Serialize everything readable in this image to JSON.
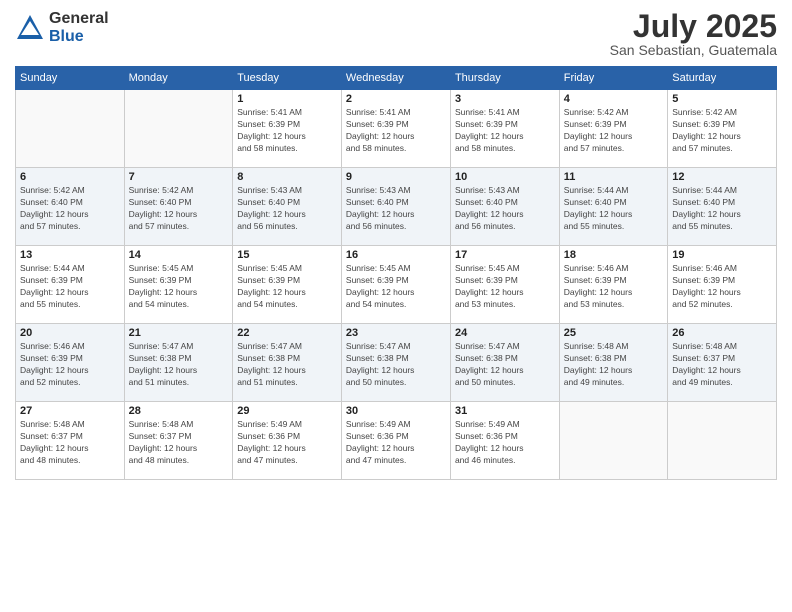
{
  "logo": {
    "general": "General",
    "blue": "Blue"
  },
  "title": "July 2025",
  "location": "San Sebastian, Guatemala",
  "days_of_week": [
    "Sunday",
    "Monday",
    "Tuesday",
    "Wednesday",
    "Thursday",
    "Friday",
    "Saturday"
  ],
  "weeks": [
    [
      {
        "day": "",
        "info": ""
      },
      {
        "day": "",
        "info": ""
      },
      {
        "day": "1",
        "info": "Sunrise: 5:41 AM\nSunset: 6:39 PM\nDaylight: 12 hours\nand 58 minutes."
      },
      {
        "day": "2",
        "info": "Sunrise: 5:41 AM\nSunset: 6:39 PM\nDaylight: 12 hours\nand 58 minutes."
      },
      {
        "day": "3",
        "info": "Sunrise: 5:41 AM\nSunset: 6:39 PM\nDaylight: 12 hours\nand 58 minutes."
      },
      {
        "day": "4",
        "info": "Sunrise: 5:42 AM\nSunset: 6:39 PM\nDaylight: 12 hours\nand 57 minutes."
      },
      {
        "day": "5",
        "info": "Sunrise: 5:42 AM\nSunset: 6:39 PM\nDaylight: 12 hours\nand 57 minutes."
      }
    ],
    [
      {
        "day": "6",
        "info": "Sunrise: 5:42 AM\nSunset: 6:40 PM\nDaylight: 12 hours\nand 57 minutes."
      },
      {
        "day": "7",
        "info": "Sunrise: 5:42 AM\nSunset: 6:40 PM\nDaylight: 12 hours\nand 57 minutes."
      },
      {
        "day": "8",
        "info": "Sunrise: 5:43 AM\nSunset: 6:40 PM\nDaylight: 12 hours\nand 56 minutes."
      },
      {
        "day": "9",
        "info": "Sunrise: 5:43 AM\nSunset: 6:40 PM\nDaylight: 12 hours\nand 56 minutes."
      },
      {
        "day": "10",
        "info": "Sunrise: 5:43 AM\nSunset: 6:40 PM\nDaylight: 12 hours\nand 56 minutes."
      },
      {
        "day": "11",
        "info": "Sunrise: 5:44 AM\nSunset: 6:40 PM\nDaylight: 12 hours\nand 55 minutes."
      },
      {
        "day": "12",
        "info": "Sunrise: 5:44 AM\nSunset: 6:40 PM\nDaylight: 12 hours\nand 55 minutes."
      }
    ],
    [
      {
        "day": "13",
        "info": "Sunrise: 5:44 AM\nSunset: 6:39 PM\nDaylight: 12 hours\nand 55 minutes."
      },
      {
        "day": "14",
        "info": "Sunrise: 5:45 AM\nSunset: 6:39 PM\nDaylight: 12 hours\nand 54 minutes."
      },
      {
        "day": "15",
        "info": "Sunrise: 5:45 AM\nSunset: 6:39 PM\nDaylight: 12 hours\nand 54 minutes."
      },
      {
        "day": "16",
        "info": "Sunrise: 5:45 AM\nSunset: 6:39 PM\nDaylight: 12 hours\nand 54 minutes."
      },
      {
        "day": "17",
        "info": "Sunrise: 5:45 AM\nSunset: 6:39 PM\nDaylight: 12 hours\nand 53 minutes."
      },
      {
        "day": "18",
        "info": "Sunrise: 5:46 AM\nSunset: 6:39 PM\nDaylight: 12 hours\nand 53 minutes."
      },
      {
        "day": "19",
        "info": "Sunrise: 5:46 AM\nSunset: 6:39 PM\nDaylight: 12 hours\nand 52 minutes."
      }
    ],
    [
      {
        "day": "20",
        "info": "Sunrise: 5:46 AM\nSunset: 6:39 PM\nDaylight: 12 hours\nand 52 minutes."
      },
      {
        "day": "21",
        "info": "Sunrise: 5:47 AM\nSunset: 6:38 PM\nDaylight: 12 hours\nand 51 minutes."
      },
      {
        "day": "22",
        "info": "Sunrise: 5:47 AM\nSunset: 6:38 PM\nDaylight: 12 hours\nand 51 minutes."
      },
      {
        "day": "23",
        "info": "Sunrise: 5:47 AM\nSunset: 6:38 PM\nDaylight: 12 hours\nand 50 minutes."
      },
      {
        "day": "24",
        "info": "Sunrise: 5:47 AM\nSunset: 6:38 PM\nDaylight: 12 hours\nand 50 minutes."
      },
      {
        "day": "25",
        "info": "Sunrise: 5:48 AM\nSunset: 6:38 PM\nDaylight: 12 hours\nand 49 minutes."
      },
      {
        "day": "26",
        "info": "Sunrise: 5:48 AM\nSunset: 6:37 PM\nDaylight: 12 hours\nand 49 minutes."
      }
    ],
    [
      {
        "day": "27",
        "info": "Sunrise: 5:48 AM\nSunset: 6:37 PM\nDaylight: 12 hours\nand 48 minutes."
      },
      {
        "day": "28",
        "info": "Sunrise: 5:48 AM\nSunset: 6:37 PM\nDaylight: 12 hours\nand 48 minutes."
      },
      {
        "day": "29",
        "info": "Sunrise: 5:49 AM\nSunset: 6:36 PM\nDaylight: 12 hours\nand 47 minutes."
      },
      {
        "day": "30",
        "info": "Sunrise: 5:49 AM\nSunset: 6:36 PM\nDaylight: 12 hours\nand 47 minutes."
      },
      {
        "day": "31",
        "info": "Sunrise: 5:49 AM\nSunset: 6:36 PM\nDaylight: 12 hours\nand 46 minutes."
      },
      {
        "day": "",
        "info": ""
      },
      {
        "day": "",
        "info": ""
      }
    ]
  ]
}
